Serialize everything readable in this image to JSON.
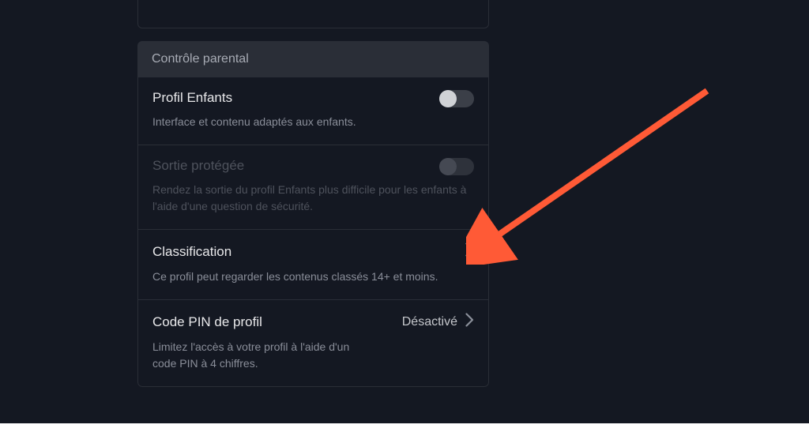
{
  "parental": {
    "header": "Contrôle parental",
    "items": {
      "kidsProfile": {
        "title": "Profil Enfants",
        "desc": "Interface et contenu adaptés aux enfants.",
        "enabled": false
      },
      "protectedExit": {
        "title": "Sortie protégée",
        "desc": "Rendez la sortie du profil Enfants plus difficile pour les enfants à l'aide d'une question de sécurité.",
        "enabled": false
      },
      "classification": {
        "title": "Classification",
        "desc": "Ce profil peut regarder les contenus classés 14+ et moins."
      },
      "profilePin": {
        "title": "Code PIN de profil",
        "status": "Désactivé",
        "desc": "Limitez l'accès à votre profil à l'aide d'un code PIN à 4 chiffres."
      }
    }
  }
}
